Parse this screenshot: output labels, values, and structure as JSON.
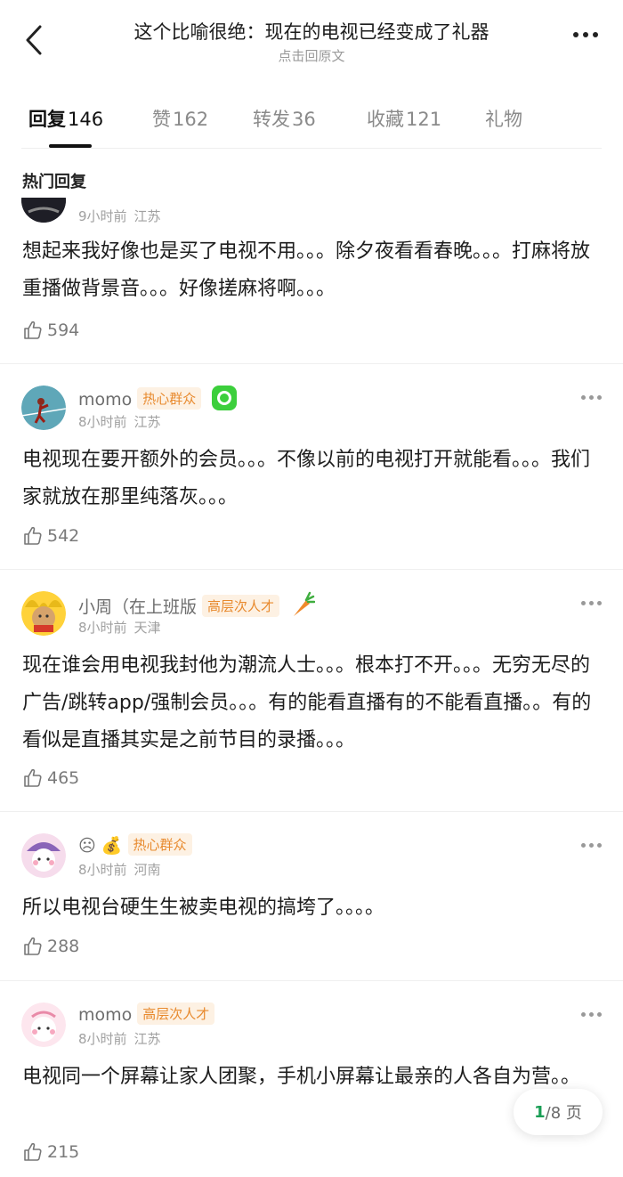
{
  "header": {
    "title": "这个比喻很绝：现在的电视已经变成了礼器",
    "subtitle": "点击回原文"
  },
  "tabs": [
    {
      "label": "回复",
      "count": "146"
    },
    {
      "label": "赞",
      "count": "162"
    },
    {
      "label": "转发",
      "count": "36"
    },
    {
      "label": "收藏",
      "count": "121"
    },
    {
      "label": "礼物",
      "count": ""
    }
  ],
  "section_title": "热门回复",
  "comments": [
    {
      "time": "9小时前",
      "location": "江苏",
      "text": "想起来我好像也是买了电视不用。。。除夕夜看看春晚。。。打麻将放重播做背景音。。。好像搓麻将啊。。。",
      "likes": "594"
    },
    {
      "name": "momo",
      "badge": "热心群众",
      "time": "8小时前",
      "location": "江苏",
      "text": "电视现在要开额外的会员。。。不像以前的电视打开就能看。。。我们家就放在那里纯落灰。。。",
      "likes": "542"
    },
    {
      "name": "小周（在上班版",
      "badge": "高层次人才",
      "time": "8小时前",
      "location": "天津",
      "text": "现在谁会用电视我封他为潮流人士。。。根本打不开。。。无穷无尽的广告/跳转app/强制会员。。。有的能看直播有的不能看直播。。有的看似是直播其实是之前节目的录播。。。",
      "likes": "465"
    },
    {
      "name": "☹",
      "name_emoji": "💰",
      "badge": "热心群众",
      "time": "8小时前",
      "location": "河南",
      "text": "所以电视台硬生生被卖电视的搞垮了。。。。",
      "likes": "288"
    },
    {
      "name": "momo",
      "badge": "高层次人才",
      "time": "8小时前",
      "location": "江苏",
      "text": "电视同一个屏幕让家人团聚，手机小屏幕让最亲的人各自为营。。",
      "likes": "215"
    }
  ],
  "pager": {
    "current": "1",
    "total": "/8 页"
  },
  "colors": {
    "accent": "#1a9e55",
    "badge": "#e88a2e"
  }
}
